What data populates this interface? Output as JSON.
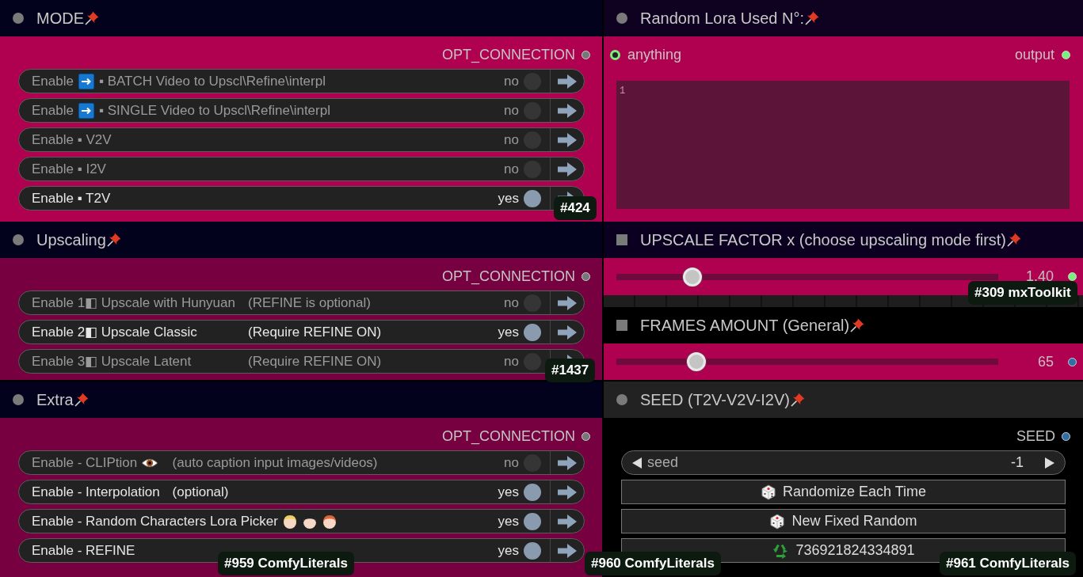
{
  "columns": [
    {
      "nodes": [
        {
          "kind": "toggles",
          "title": "MODE",
          "pinned": true,
          "color": "#b00050",
          "output": {
            "label": "OPT_CONNECTION",
            "color": "#777777"
          },
          "rows": [
            {
              "parts": [
                {
                  "kind": "text",
                  "text": "Enable"
                },
                {
                  "kind": "arrow"
                },
                {
                  "kind": "text",
                  "text": "▪ BATCH Video to Upscl\\Refine\\interpl"
                }
              ],
              "value": "no",
              "on": false
            },
            {
              "parts": [
                {
                  "kind": "text",
                  "text": "Enable"
                },
                {
                  "kind": "arrow"
                },
                {
                  "kind": "text",
                  "text": "▪ SINGLE Video to Upscl\\Refine\\interpl"
                }
              ],
              "value": "no",
              "on": false
            },
            {
              "parts": [
                {
                  "kind": "text",
                  "text": "Enable ▪ V2V"
                }
              ],
              "value": "no",
              "on": false
            },
            {
              "parts": [
                {
                  "kind": "text",
                  "text": "Enable ▪ I2V"
                }
              ],
              "value": "no",
              "on": false
            },
            {
              "parts": [
                {
                  "kind": "text",
                  "text": "Enable ▪ T2V"
                }
              ],
              "value": "yes",
              "on": true
            }
          ]
        },
        {
          "kind": "toggles",
          "title": "Upscaling",
          "pinned": true,
          "color": "#760040",
          "output": {
            "label": "OPT_CONNECTION",
            "color": "#777777"
          },
          "rows": [
            {
              "parts": [
                {
                  "kind": "text",
                  "text": "Enable 1◧ Upscale with Hunyuan"
                }
              ],
              "note": "(REFINE is optional)",
              "value": "no",
              "on": false
            },
            {
              "parts": [
                {
                  "kind": "text",
                  "text": "Enable 2◧ Upscale Classic"
                }
              ],
              "note": "(Require REFINE ON)",
              "value": "yes",
              "on": true
            },
            {
              "parts": [
                {
                  "kind": "text",
                  "text": "Enable 3◧ Upscale Latent"
                }
              ],
              "note": "(Require REFINE ON)",
              "value": "no",
              "on": false
            }
          ]
        },
        {
          "kind": "toggles",
          "title": "Extra",
          "pinned": true,
          "color": "#760040",
          "output": {
            "label": "OPT_CONNECTION",
            "color": "#777777"
          },
          "rows": [
            {
              "parts": [
                {
                  "kind": "text",
                  "text": "Enable - CLIPtion"
                },
                {
                  "kind": "eye"
                }
              ],
              "note": "(auto caption input images/videos)",
              "value": "no",
              "on": false
            },
            {
              "parts": [
                {
                  "kind": "text",
                  "text": "Enable - Interpolation"
                }
              ],
              "note": "(optional)",
              "value": "yes",
              "on": true
            },
            {
              "parts": [
                {
                  "kind": "text",
                  "text": "Enable - Random Characters Lora Picker"
                },
                {
                  "kind": "person"
                },
                {
                  "kind": "person"
                },
                {
                  "kind": "person"
                }
              ],
              "value": "yes",
              "on": true
            },
            {
              "parts": [
                {
                  "kind": "text",
                  "text": "Enable - REFINE"
                }
              ],
              "value": "yes",
              "on": true
            }
          ]
        }
      ]
    },
    {
      "nodes": [
        {
          "kind": "text",
          "title": "Random Lora Used N°:",
          "pinned": true,
          "color": "#b00050",
          "input": {
            "label": "anything",
            "color": "#7cf07c"
          },
          "output": {
            "label": "output",
            "color": "#7cf07c"
          },
          "editor": {
            "line_numbers": [
              "1"
            ]
          }
        },
        {
          "kind": "slider",
          "title": "UPSCALE FACTOR x (choose upscaling mode first)",
          "pinned": true,
          "color": "#b00050",
          "value": "1.40",
          "level": 0.2,
          "output": {
            "color": "#7cf07c"
          }
        },
        {
          "kind": "grid"
        },
        {
          "kind": "slider",
          "title": "FRAMES AMOUNT (General)",
          "pinned": true,
          "color": "#b00050",
          "value": "65",
          "level": 0.21,
          "output": {
            "color": "#2f6fa8"
          }
        },
        {
          "kind": "seed",
          "title": "SEED (T2V-V2V-I2V)",
          "pinned": true,
          "color": "#000000",
          "output": {
            "label": "SEED",
            "color": "#2f6fa8"
          },
          "widget": {
            "label": "seed",
            "value": "-1"
          },
          "buttons": [
            {
              "kind": "dice",
              "label": "Randomize Each Time"
            },
            {
              "kind": "dice",
              "label": "New Fixed Random"
            },
            {
              "kind": "recycle",
              "label": "736921824334891"
            }
          ]
        }
      ]
    }
  ],
  "badges": [
    "#424",
    "#1437",
    "#309 mxToolkit",
    "#959 ComfyLiterals",
    "#960 ComfyLiterals",
    "#961 ComfyLiterals"
  ]
}
